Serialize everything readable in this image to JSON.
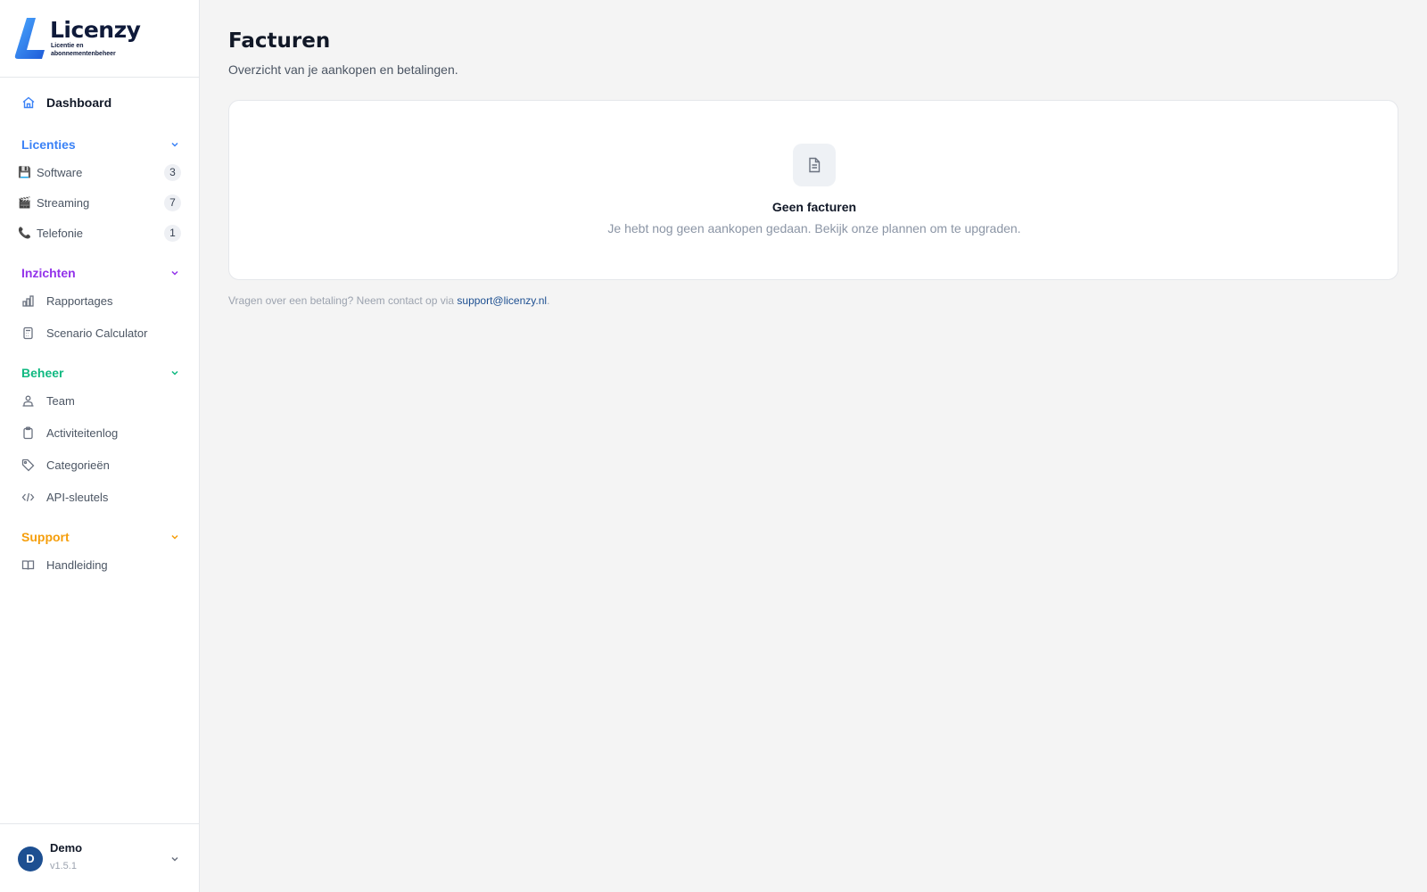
{
  "brand": {
    "name": "Licenzy",
    "tagline": "Licentie en abonnementenbeheer"
  },
  "nav": {
    "dashboard": "Dashboard",
    "sections": {
      "licenties": {
        "title": "Licenties",
        "color": "#3b82f6",
        "items": [
          {
            "label": "Software",
            "count": "3",
            "icon": "floppy-disk-icon"
          },
          {
            "label": "Streaming",
            "count": "7",
            "icon": "clapper-board-icon"
          },
          {
            "label": "Telefonie",
            "count": "1",
            "icon": "telephone-icon"
          }
        ]
      },
      "inzichten": {
        "title": "Inzichten",
        "color": "#9333ea",
        "items": [
          {
            "label": "Rapportages",
            "icon": "bar-chart-icon"
          },
          {
            "label": "Scenario Calculator",
            "icon": "calculator-icon"
          }
        ]
      },
      "beheer": {
        "title": "Beheer",
        "color": "#10b981",
        "items": [
          {
            "label": "Team",
            "icon": "team-icon"
          },
          {
            "label": "Activiteitenlog",
            "icon": "clipboard-icon"
          },
          {
            "label": "Categorieën",
            "icon": "tag-icon"
          },
          {
            "label": "API-sleutels",
            "icon": "code-icon"
          }
        ]
      },
      "support": {
        "title": "Support",
        "color": "#f59e0b",
        "items": [
          {
            "label": "Handleiding",
            "icon": "book-icon"
          }
        ]
      }
    }
  },
  "user": {
    "initial": "D",
    "name": "Demo",
    "version": "v1.5.1"
  },
  "page": {
    "title": "Facturen",
    "subtitle": "Overzicht van je aankopen en betalingen.",
    "empty_title": "Geen facturen",
    "empty_desc": "Je hebt nog geen aankopen gedaan. Bekijk onze plannen om te upgraden.",
    "footer_prefix": "Vragen over een betaling? Neem contact op via ",
    "footer_link": "support@licenzy.nl",
    "footer_suffix": "."
  }
}
